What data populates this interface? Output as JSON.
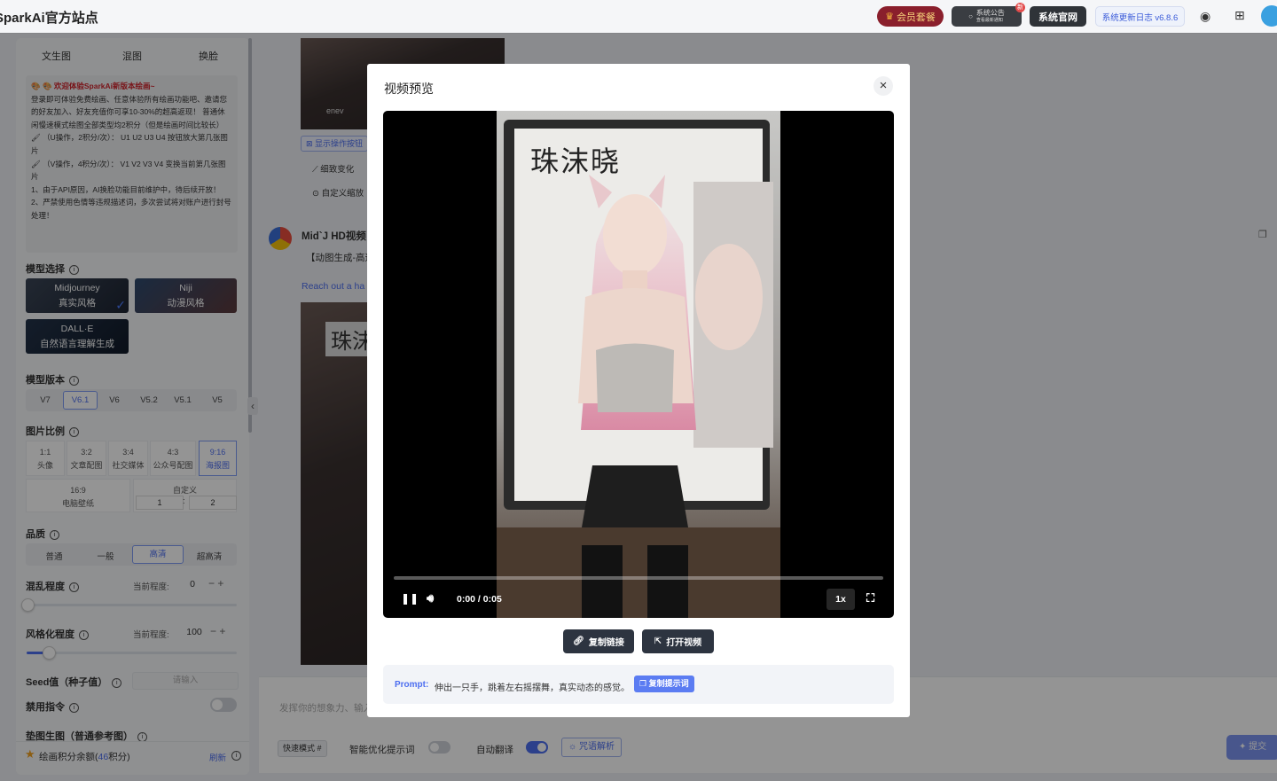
{
  "header": {
    "site_title": "SparkAi官方站点",
    "vip_label": "会员套餐",
    "announce_label": "系统公告",
    "announce_sub": "查看最新通知",
    "announce_badge": "新",
    "official_label": "系统官网",
    "changelog_label": "系统更新日志 v6.8.6"
  },
  "left": {
    "tabs": [
      "文生图",
      "混图",
      "换脸"
    ],
    "notice": {
      "title": "🎨 🎨 欢迎体验SparkAi新版本绘画~",
      "lines": [
        "登录即可体验免费绘画、任意体验所有绘画功能吧、邀请您的好友加入、好友充值你可享10-30%的超高返现！ 普通休闲慢速模式绘图全部类型均2积分（但是绘画时间比较长）",
        "🖌 （U操作，2积分/次）： U1 U2 U3 U4 按钮放大第几张图片",
        "🖌 （V操作，4积分/次）： V1 V2 V3 V4 变换当前第几张图片",
        "1、由于API原因，AI换脸功能目前维护中，待后续开放！",
        "2、严禁使用色情等违规描述词，多次尝试将对账户进行封号处理！"
      ]
    },
    "model_title": "模型选择",
    "models": [
      {
        "name": "Midjourney",
        "desc": "真实风格"
      },
      {
        "name": "Niji",
        "desc": "动漫风格"
      },
      {
        "name": "DALL·E",
        "desc": "自然语言理解生成"
      }
    ],
    "version_title": "模型版本",
    "versions": [
      "V7",
      "V6.1",
      "V6",
      "V5.2",
      "V5.1",
      "V5"
    ],
    "ratio_title": "图片比例",
    "ratios": [
      {
        "r": "1:1",
        "d": "头像"
      },
      {
        "r": "3:2",
        "d": "文章配图"
      },
      {
        "r": "3:4",
        "d": "社交媒体"
      },
      {
        "r": "4:3",
        "d": "公众号配图"
      },
      {
        "r": "9:16",
        "d": "海报图"
      }
    ],
    "ratio_wide": {
      "r": "16:9",
      "d": "电脑壁纸"
    },
    "custom_label": "自定义",
    "custom_w": "1",
    "custom_sep": ":",
    "custom_h": "2",
    "quality_title": "品质",
    "qualities": [
      "普通",
      "一般",
      "高清",
      "超高清"
    ],
    "chaos_title": "混乱程度",
    "current_level_label": "当前程度:",
    "chaos_value": "0",
    "chaos_fraction": 0.0,
    "stylize_title": "风格化程度",
    "stylize_value": "100",
    "stylize_fraction": 0.1,
    "seed_title": "Seed值（种子值）",
    "seed_placeholder": "请输入",
    "ban_title": "禁用指令",
    "pad_title": "垫图生图（普通参考图）",
    "credits_prefix": "绘画积分余额(",
    "credits_value": "46",
    "credits_suffix": "积分)",
    "refresh_label": "刷新",
    "collapse_icon": "‹"
  },
  "content": {
    "user_name": "enev",
    "show_ops": "显示操作按钮",
    "variation": "细致变化",
    "custom_zoom": "自定义缩放",
    "bot_name": "Mid`J HD视频",
    "bot_desc": "【动图生成-高速",
    "bot_link": "Reach out a ha",
    "image_text": "珠沫",
    "input_placeholder": "发挥你的想象力、输入",
    "fast_mode": "快速模式 #",
    "smart_prompt": "智能优化提示词",
    "auto_translate": "自动翻译",
    "spell_parse": "咒语解析",
    "submit": "提交"
  },
  "modal": {
    "title": "视频预览",
    "close_icon": "×",
    "screen_text": "珠沫晓",
    "time": "0:00 / 0:05",
    "speed": "1x",
    "progress": 0.0,
    "copy_link": "复制链接",
    "open_video": "打开视频",
    "prompt_label": "Prompt:",
    "prompt_text": "伸出一只手，跳着左右摇摆舞，真实动态的感觉。",
    "copy_prompt": "复制提示词"
  }
}
